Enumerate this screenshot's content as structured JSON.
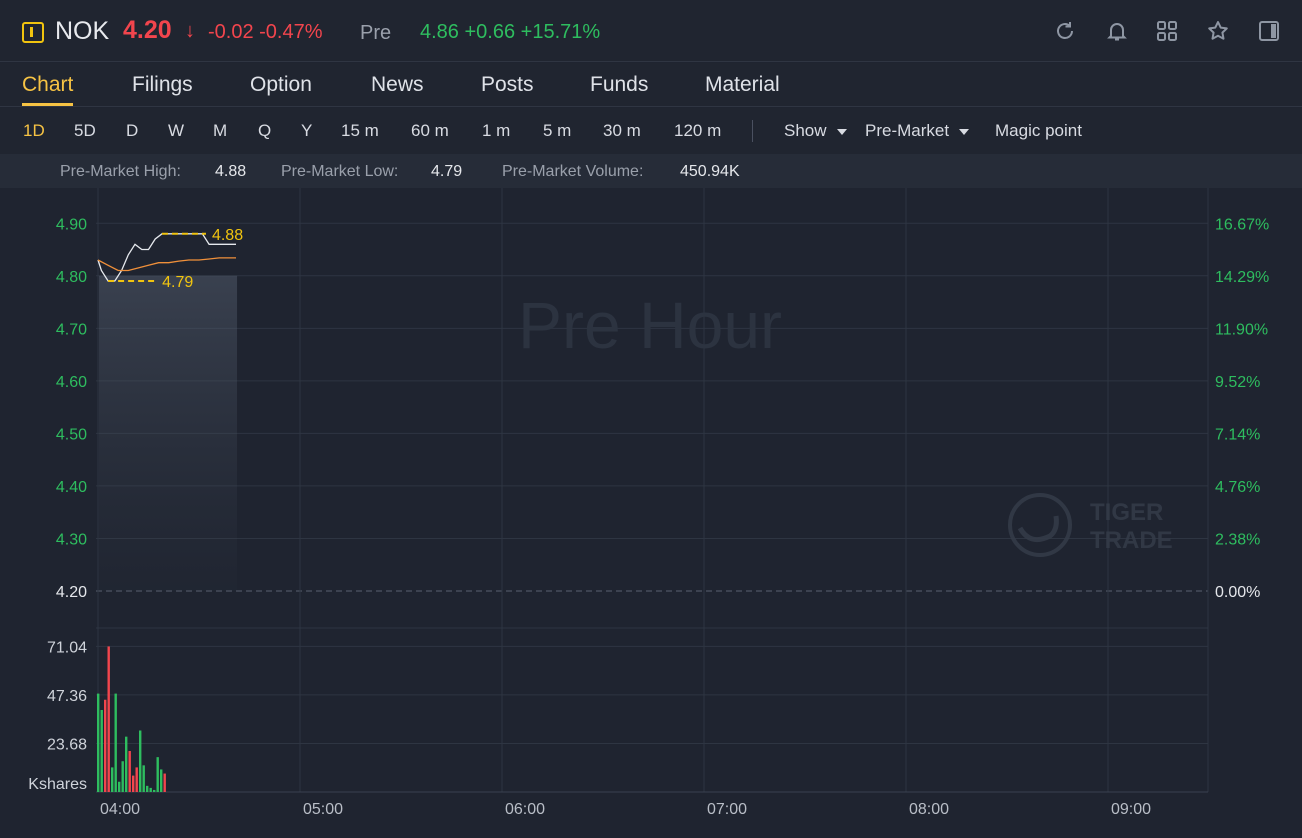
{
  "header": {
    "symbol": "NOK",
    "last_price": "4.20",
    "arrow": "↓",
    "change": "-0.02 -0.47%",
    "pre_label": "Pre",
    "pre_values": "4.86 +0.66 +15.71%",
    "icons": [
      "refresh-icon",
      "bell-icon",
      "grid-icon",
      "star-icon",
      "panel-icon"
    ]
  },
  "tabs": [
    "Chart",
    "Filings",
    "Option",
    "News",
    "Posts",
    "Funds",
    "Material"
  ],
  "toolbar": {
    "periods": [
      "1D",
      "5D",
      "D",
      "W",
      "M",
      "Q",
      "Y",
      "15 m",
      "60 m",
      "1 m",
      "5 m",
      "30 m",
      "120 m"
    ],
    "show": "Show",
    "session": "Pre-Market",
    "magic": "Magic point"
  },
  "stats": {
    "high_label": "Pre-Market High:",
    "high": "4.88",
    "low_label": "Pre-Market Low:",
    "low": "4.79",
    "volume_label": "Pre-Market Volume:",
    "volume": "450.94K"
  },
  "chart_data": {
    "type": "line",
    "watermark": "Pre Hour",
    "brand_watermark": [
      "TIGER",
      "TRADE"
    ],
    "y_ticks": [
      "4.90",
      "4.80",
      "4.70",
      "4.60",
      "4.50",
      "4.40",
      "4.30",
      "4.20"
    ],
    "y_right_ticks": [
      "16.67%",
      "14.29%",
      "11.90%",
      "9.52%",
      "7.14%",
      "4.76%",
      "2.38%",
      "0.00%"
    ],
    "ylim": [
      4.2,
      4.91
    ],
    "x_ticks": [
      "04:00",
      "05:00",
      "06:00",
      "07:00",
      "08:00",
      "09:00"
    ],
    "high_marker": "4.88",
    "low_marker": "4.79",
    "series": [
      {
        "name": "",
        "color": "#e6e9ee",
        "x": [
          "04:00",
          "04:01",
          "04:03",
          "04:05",
          "04:07",
          "04:09",
          "04:11",
          "04:13",
          "04:15",
          "04:17",
          "04:19",
          "04:21",
          "04:23",
          "04:25",
          "04:27",
          "04:29",
          "04:31",
          "04:33",
          "04:35",
          "04:37",
          "04:39",
          "04:41"
        ],
        "values": [
          4.83,
          4.81,
          4.79,
          4.79,
          4.81,
          4.84,
          4.86,
          4.85,
          4.85,
          4.87,
          4.88,
          4.88,
          4.88,
          4.88,
          4.88,
          4.88,
          4.88,
          4.86,
          4.86,
          4.86,
          4.86,
          4.86
        ]
      },
      {
        "name": "",
        "color": "#f0903a",
        "x": [
          "04:00",
          "04:03",
          "04:06",
          "04:09",
          "04:12",
          "04:15",
          "04:18",
          "04:21",
          "04:24",
          "04:27",
          "04:30",
          "04:33",
          "04:36",
          "04:39",
          "04:41"
        ],
        "values": [
          4.83,
          4.82,
          4.81,
          4.81,
          4.815,
          4.82,
          4.825,
          4.825,
          4.828,
          4.83,
          4.83,
          4.832,
          4.834,
          4.834,
          4.834
        ]
      }
    ],
    "volume": {
      "unit": "Kshares",
      "ticks": [
        "71.04",
        "47.36",
        "23.68"
      ],
      "max": 80,
      "bars": [
        {
          "v": 48,
          "c": "up"
        },
        {
          "v": 40,
          "c": "up"
        },
        {
          "v": 45,
          "c": "down"
        },
        {
          "v": 71,
          "c": "down"
        },
        {
          "v": 12,
          "c": "up"
        },
        {
          "v": 48,
          "c": "up"
        },
        {
          "v": 5,
          "c": "up"
        },
        {
          "v": 15,
          "c": "up"
        },
        {
          "v": 27,
          "c": "up"
        },
        {
          "v": 20,
          "c": "down"
        },
        {
          "v": 8,
          "c": "down"
        },
        {
          "v": 12,
          "c": "down"
        },
        {
          "v": 30,
          "c": "up"
        },
        {
          "v": 13,
          "c": "up"
        },
        {
          "v": 3,
          "c": "up"
        },
        {
          "v": 2,
          "c": "up"
        },
        {
          "v": 1,
          "c": "up"
        },
        {
          "v": 17,
          "c": "up"
        },
        {
          "v": 11,
          "c": "up"
        },
        {
          "v": 9,
          "c": "down"
        }
      ]
    },
    "grid": true
  },
  "colors": {
    "up": "#2ebd5f",
    "down": "#f2454d",
    "accent": "#f6c344",
    "marker": "#f1c40f"
  }
}
